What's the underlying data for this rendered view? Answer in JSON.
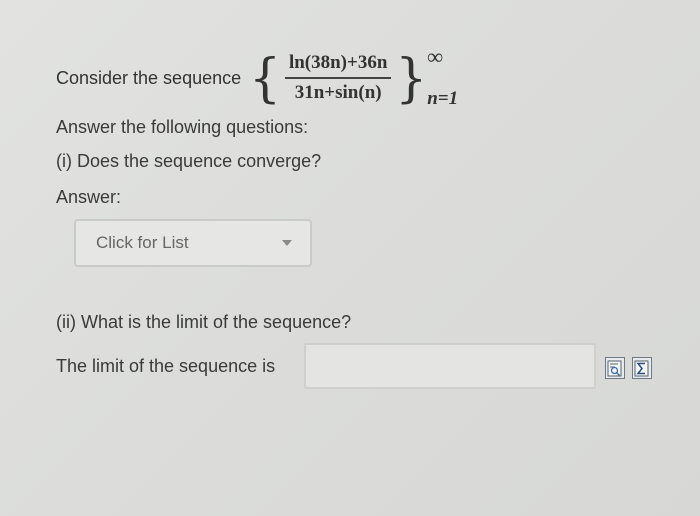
{
  "question": {
    "intro": "Consider the sequence",
    "sequence": {
      "numerator": "ln(38n)+36n",
      "denominator": "31n+sin(n)",
      "upper_limit": "∞",
      "lower_limit": "n=1"
    },
    "instruction": "Answer the following questions:"
  },
  "part1": {
    "question": "(i) Does the sequence converge?",
    "answer_label": "Answer:",
    "dropdown_selected": "Click for List"
  },
  "part2": {
    "question": "(ii) What is the limit of the sequence?",
    "input_label": "The limit of the sequence is",
    "input_value": ""
  },
  "tools": [
    {
      "icon": "preview-icon"
    },
    {
      "icon": "equation-editor-icon"
    }
  ]
}
